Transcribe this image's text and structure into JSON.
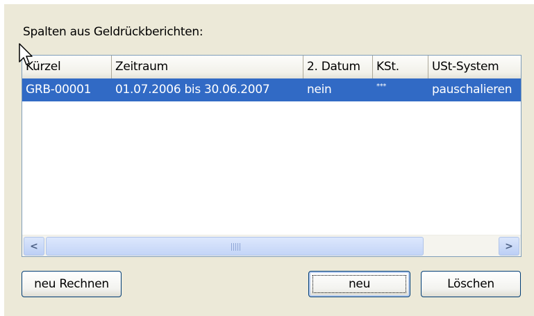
{
  "section_label": "Spalten aus Geldrückberichten:",
  "table": {
    "columns": [
      "Kürzel",
      "Zeitraum",
      "2. Datum",
      "KSt.",
      "USt-System"
    ],
    "rows": [
      [
        "GRB-00001",
        "01.07.2006 bis 30.06.2007",
        "nein",
        "***",
        "pauschalieren"
      ]
    ],
    "selected_row": 0
  },
  "buttons": {
    "recalc_label": "neu Rechnen",
    "new_label": "neu",
    "delete_label": "Löschen"
  },
  "scrollbar": {
    "left_arrow": "<",
    "right_arrow": ">"
  },
  "colors": {
    "selection": "#316ac5",
    "dialog_bg": "#ece9d8",
    "button_border": "#003c74"
  }
}
